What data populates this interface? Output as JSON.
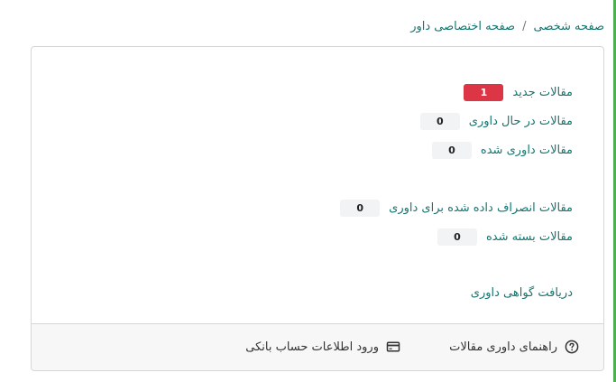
{
  "breadcrumb": {
    "items": [
      "صفحه شخصی",
      "صفحه اختصاصی داور"
    ],
    "separator": "/"
  },
  "stats": [
    {
      "label": "مقالات جدید",
      "count": "1",
      "status": "danger"
    },
    {
      "label": "مقالات در حال داوری",
      "count": "0",
      "status": "default"
    },
    {
      "label": "مقالات داوری شده",
      "count": "0",
      "status": "default"
    },
    {
      "label": "مقالات انصراف داده شده برای داوری",
      "count": "0",
      "status": "default"
    },
    {
      "label": "مقالات بسته شده",
      "count": "0",
      "status": "default"
    }
  ],
  "certificate_link": "دریافت گواهی داوری",
  "footer": {
    "guide": {
      "label": "راهنمای داوری مقالات",
      "icon": "question-circle-icon"
    },
    "bank": {
      "label": "ورود اطلاعات حساب بانکی",
      "icon": "credit-card-icon"
    }
  },
  "colors": {
    "link": "#157570",
    "danger": "#dc3545",
    "badge_bg": "#f1f3f5",
    "accent_strip": "#4caf50"
  }
}
